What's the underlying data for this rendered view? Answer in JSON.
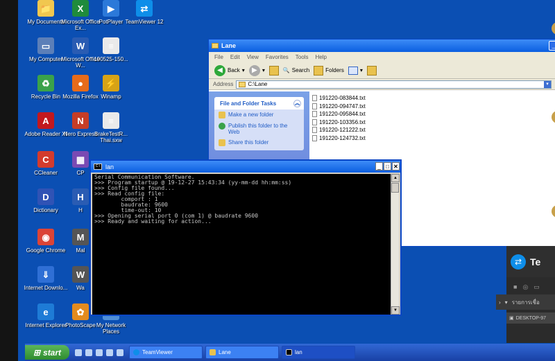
{
  "desktop": {
    "icons": [
      {
        "label": "My Documents",
        "icon": "my-documents-icon",
        "color": "#f1c74f",
        "glyph": "📁"
      },
      {
        "label": "Microsoft Office Ex...",
        "icon": "excel-icon",
        "color": "#1f8b3c",
        "glyph": "X"
      },
      {
        "label": "PotPlayer",
        "icon": "potplayer-icon",
        "color": "#2c79d9",
        "glyph": "▶"
      },
      {
        "label": "TeamViewer 12",
        "icon": "teamviewer-icon",
        "color": "#0e8ee9",
        "glyph": "⇄"
      },
      {
        "label": "My Computer",
        "icon": "my-computer-icon",
        "color": "#5c7fb8",
        "glyph": "▭"
      },
      {
        "label": "Microsoft Office W...",
        "icon": "word-icon",
        "color": "#2a5cb3",
        "glyph": "W"
      },
      {
        "label": "190525-150...",
        "icon": "document-icon",
        "color": "#eaeaea",
        "glyph": "≡"
      },
      {
        "label": "Recycle Bin",
        "icon": "recycle-bin-icon",
        "color": "#3aa24a",
        "glyph": "♻"
      },
      {
        "label": "Mozilla Firefox",
        "icon": "firefox-icon",
        "color": "#e66b1a",
        "glyph": "●"
      },
      {
        "label": "Winamp",
        "icon": "winamp-icon",
        "color": "#d7a316",
        "glyph": "⚡"
      },
      {
        "label": "Adobe Reader XI",
        "icon": "adobe-reader-icon",
        "color": "#c2181e",
        "glyph": "A"
      },
      {
        "label": "Nero Express",
        "icon": "nero-express-icon",
        "color": "#c63d27",
        "glyph": "N"
      },
      {
        "label": "BrakeTestR... Thai.sxw",
        "icon": "document-icon",
        "color": "#eaeaea",
        "glyph": "≡"
      },
      {
        "label": "CCleaner",
        "icon": "ccleaner-icon",
        "color": "#d33b2d",
        "glyph": "C"
      },
      {
        "label": "CP",
        "icon": "cpu-icon",
        "color": "#7a4ab3",
        "glyph": "▦"
      },
      {
        "label": "Dictionary",
        "icon": "dictionary-icon",
        "color": "#3053b5",
        "glyph": "D"
      },
      {
        "label": "H",
        "icon": "app-icon",
        "color": "#2a5cb3",
        "glyph": "H"
      },
      {
        "label": "Google Chrome",
        "icon": "chrome-icon",
        "color": "#db4437",
        "glyph": "◉"
      },
      {
        "label": "Mal",
        "icon": "app-icon",
        "color": "#555555",
        "glyph": "M"
      },
      {
        "label": "Internet Downlo...",
        "icon": "idm-icon",
        "color": "#2f6fd5",
        "glyph": "⇓"
      },
      {
        "label": "Wa",
        "icon": "app-icon",
        "color": "#555555",
        "glyph": "W"
      },
      {
        "label": "Internet Explorer",
        "icon": "ie-icon",
        "color": "#1e7bd6",
        "glyph": "e"
      },
      {
        "label": "PhotoScape",
        "icon": "photoscape-icon",
        "color": "#e38b1e",
        "glyph": "✿"
      },
      {
        "label": "My Network Places",
        "icon": "network-places-icon",
        "color": "#4f8fd8",
        "glyph": "⌂"
      }
    ]
  },
  "explorer": {
    "title": "Lane",
    "menu": [
      "File",
      "Edit",
      "View",
      "Favorites",
      "Tools",
      "Help"
    ],
    "toolbar": {
      "back": "Back",
      "search": "Search",
      "folders": "Folders"
    },
    "address_label": "Address",
    "address_value": "C:\\Lane",
    "tasks": {
      "header": "File and Folder Tasks",
      "items": [
        "Make a new folder",
        "Publish this folder to the Web",
        "Share this folder"
      ]
    },
    "files": [
      "191220-083844.txt",
      "191220-094747.txt",
      "191220-095844.txt",
      "191220-103356.txt",
      "191220-121222.txt",
      "191220-124732.txt"
    ]
  },
  "console": {
    "title": "lan",
    "icon_text": "C:\\",
    "lines": [
      "Serial Communication Software.",
      ">>> Program startup @ 19-12-27 15:43:34 (yy-mm-dd hh:mm:ss)",
      ">>> Config file found...",
      ">>> Read config file:",
      "        comport : 1",
      "        baudrate: 9600",
      "        time-out: 10",
      ">>> Opening serial port 0 (com 1) @ baudrate 9600",
      ">>> Ready and waiting for action..."
    ]
  },
  "taskbar": {
    "start_label": "start",
    "tasks": [
      {
        "label": "TeamViewer",
        "icon": "teamviewer-icon"
      },
      {
        "label": "Lane",
        "icon": "folder-icon"
      },
      {
        "label": "lan",
        "icon": "console-icon"
      }
    ]
  },
  "remote_panel": {
    "title_letter": "Te",
    "session_label": "รายการเชื่อ",
    "desktop_label": "DESKTOP-97"
  }
}
